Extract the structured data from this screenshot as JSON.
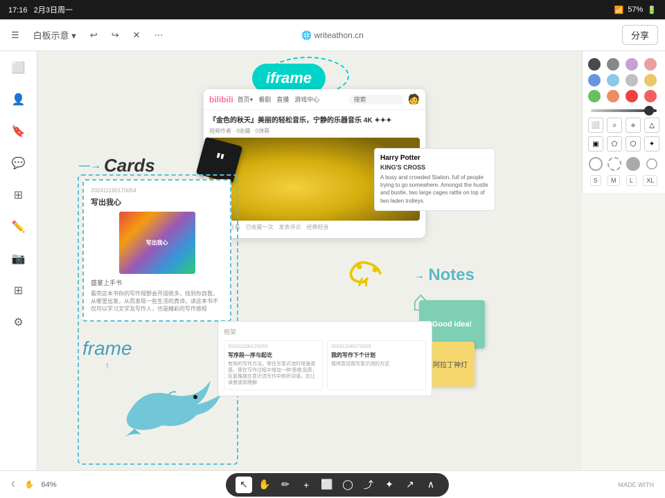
{
  "statusBar": {
    "time": "17:16",
    "date": "2月3日周一",
    "battery": "57%",
    "wifi": "WiFi"
  },
  "toolbar": {
    "appName": "白板示意",
    "centerUrl": "writeathon.cn",
    "shareLabel": "分享",
    "undoIcon": "↩",
    "redoIcon": "↪"
  },
  "sidebar": {
    "items": [
      "☰",
      "👤",
      "🔒",
      "✏️",
      "📷",
      "⊞",
      "⚙"
    ]
  },
  "rightPanel": {
    "colors": [
      "#4a4a4a",
      "#888",
      "#c8a0d8",
      "#e8a0a0",
      "#6895e0",
      "#8cc8e8",
      "#c0c0c0",
      "#e8c868",
      "#68c060",
      "#e89060",
      "#f04040",
      "#f06060"
    ],
    "shapes": [
      "rect",
      "circle",
      "diamond",
      "triangle"
    ],
    "sizes": [
      "S",
      "M",
      "L",
      "XL"
    ]
  },
  "canvas": {
    "iframeLabel": "iframe",
    "cardsLabel": "Cards",
    "frameLabel": "frame",
    "notesLabel": "Notes",
    "stickyGreenText": "Good idea!",
    "stickyYellowText": "召唤阿拉丁神灯",
    "blackCardSymbol": "❝",
    "biliTitle": "『金色的秋天』美丽的轻松音乐，宁静的乐器音乐 4K ✦✦✦",
    "biliMeta": "1人正在看  已收藏一次  发表评论  经典轻音",
    "cardId": "202411190170054",
    "cardTitle": "写出我心",
    "cardSubtitle": "盛宴上手书",
    "cardBody": "看完这本书你的写作视野会开阔很多，找到你自我，从哪里出发，从而发现一些生活的真谛。读这本书不仅可以学习文学及写作人，也是精彩的写作旅程",
    "hpTitle": "Harry Potter",
    "hpSubtitle": "KING'S CROSS",
    "hpBody": "A busy and crowded Station, full of people trying to go somewhere. Amongst the hustle and bustle, two large cages rattle on top of two laden trolleys.",
    "frameSectionLabel": "框架",
    "frameCard1Id": "202411190170055",
    "frameCard1Title": "写序段—序与起讫",
    "frameCard1Body": "有效的写作方法，常在写意识流时增强语感，便在写作过程中增加一种'思维'品质，反复推敲在意识流写作中转折词语，应让读者感到理解",
    "frameCard2Id": "202411190170209",
    "frameCard2Title": "我的写作下个计划",
    "frameCard2Body": "我将尝试用写意识流的方式"
  },
  "bottomBar": {
    "moonIcon": "☾",
    "handIcon": "✋",
    "zoomLevel": "64%",
    "madeWith": "MADE WITH"
  },
  "tools": [
    {
      "name": "select",
      "icon": "↖",
      "active": true
    },
    {
      "name": "hand",
      "icon": "✋",
      "active": false
    },
    {
      "name": "pen",
      "icon": "✏",
      "active": false
    },
    {
      "name": "add",
      "icon": "+",
      "active": false
    },
    {
      "name": "shape",
      "icon": "⬜",
      "active": false
    },
    {
      "name": "lasso",
      "icon": "◯",
      "active": false
    },
    {
      "name": "link",
      "icon": "⤴",
      "active": false
    },
    {
      "name": "star",
      "icon": "✦",
      "active": false
    },
    {
      "name": "arrow",
      "icon": "↗",
      "active": false
    },
    {
      "name": "collapse",
      "icon": "∧",
      "active": false
    }
  ]
}
